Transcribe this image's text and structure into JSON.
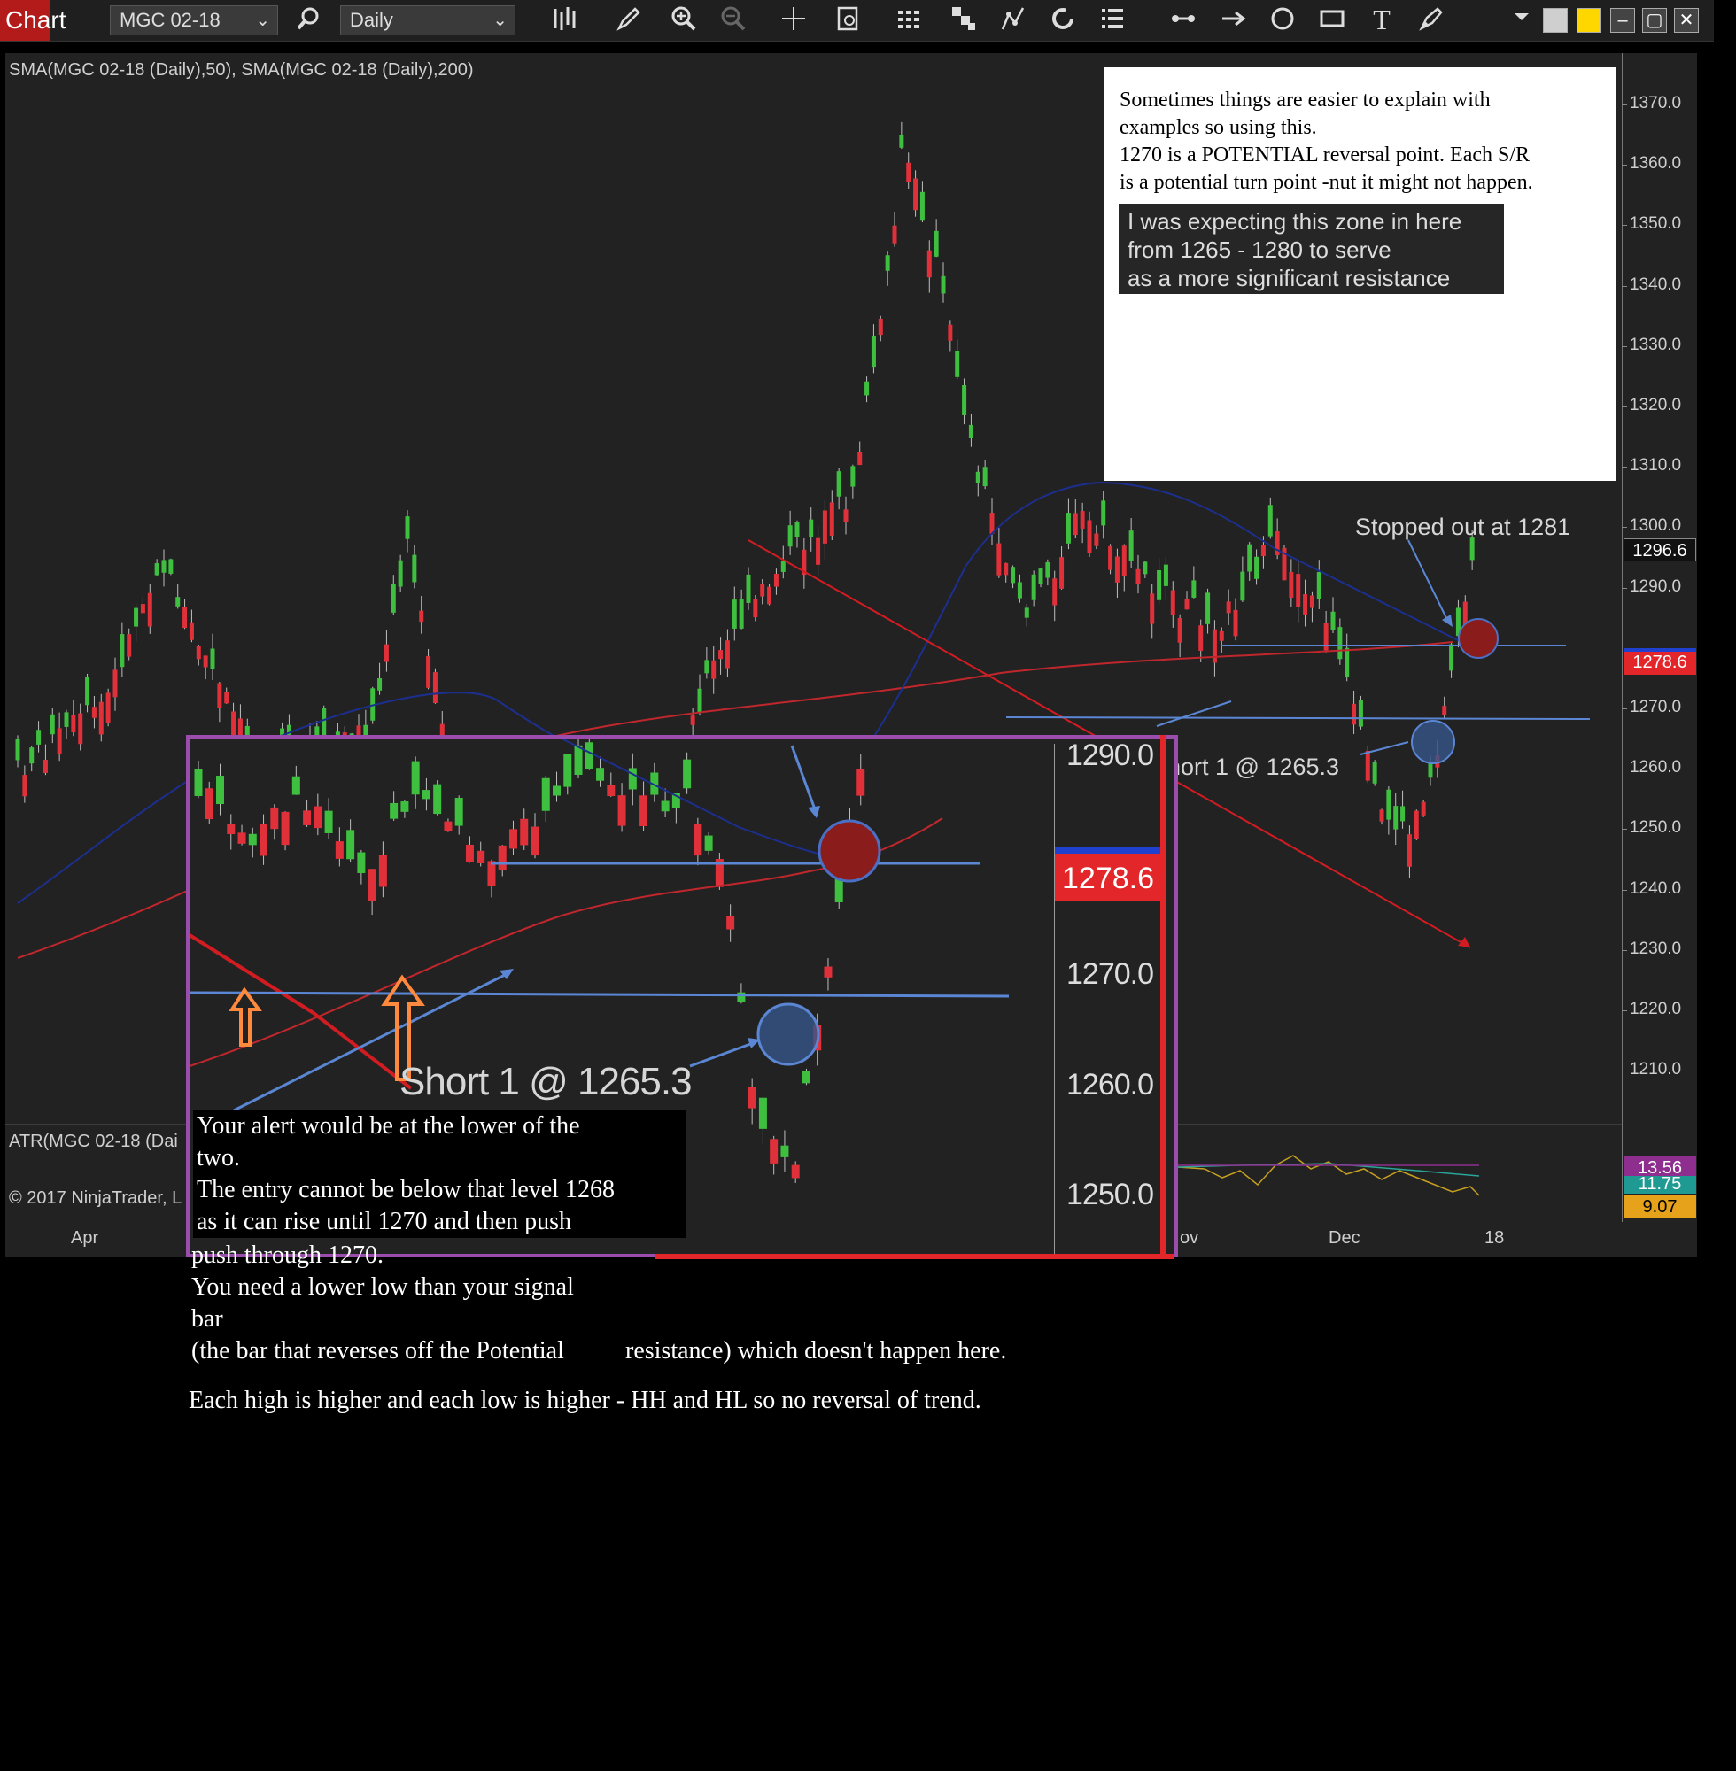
{
  "toolbar": {
    "chart_tab": "Chart",
    "instrument": "MGC 02-18",
    "interval": "Daily",
    "icons": [
      "search-icon",
      "bar-type-icon",
      "pencil-icon",
      "zoom-in-icon",
      "zoom-out-icon",
      "crosshair-icon",
      "data-box-icon",
      "properties-icon",
      "indicators-icon",
      "strategies-icon",
      "refresh-icon",
      "list-icon",
      "line-icon",
      "arrow-icon",
      "ellipse-icon",
      "rectangle-icon",
      "text-icon",
      "drawing-tools-icon",
      "dropdown-icon"
    ],
    "color_swatches": [
      "#d0d0d0",
      "#ffd700"
    ],
    "window_buttons": [
      "minimize",
      "maximize",
      "close"
    ]
  },
  "indicator_label": "SMA(MGC 02-18 (Daily),50), SMA(MGC 02-18 (Daily),200)",
  "atr_label": "ATR(MGC 02-18 (Dai",
  "copyright": "© 2017 NinjaTrader, L",
  "price_axis": {
    "ticks": [
      "1370.0",
      "1360.0",
      "1350.0",
      "1340.0",
      "1330.0",
      "1320.0",
      "1310.0",
      "1300.0",
      "1290.0",
      "1270.0",
      "1260.0",
      "1250.0",
      "1240.0",
      "1230.0",
      "1220.0",
      "1210.0"
    ],
    "last_price": "1296.6",
    "red_tag": "1278.6",
    "atr_tags": [
      "13.56",
      "11.75",
      "9.07"
    ]
  },
  "date_axis": [
    "Apr",
    "ov",
    "Dec",
    "18"
  ],
  "note_box": {
    "line1": "Sometimes things are easier to explain with",
    "line2": "examples so using this.",
    "line3": "1270 is a POTENTIAL reversal point. Each S/R",
    "line4": "is a potential turn point -nut it might not happen.",
    "dark1": "I was expecting this zone in here",
    "dark2": "from 1265 - 1280 to serve",
    "dark3": "as a more significant resistance"
  },
  "annotations": {
    "stopped": "Stopped out at 1281",
    "short_main": "hort 1 @ 1265.3",
    "short_inset": "Short 1 @ 1265.3"
  },
  "inset": {
    "ticks": [
      "1290.0",
      "1270.0",
      "1260.0",
      "1250.0"
    ],
    "red_tag": "1278.6"
  },
  "explanation": {
    "l1": "Your alert would be at the lower of the",
    "l2": "two.",
    "l3": "The entry cannot be below that level 1268",
    "l4": "as it can rise until 1270 and then push",
    "l5": "push through 1270.",
    "l6": "You need a lower low than your signal",
    "l7": "bar",
    "l8": "(the bar that reverses off the Potential",
    "l8b": "resistance) which doesn't happen here.",
    "l9": "Each high is higher and each low is higher - HH and HL so no reversal of trend."
  }
}
